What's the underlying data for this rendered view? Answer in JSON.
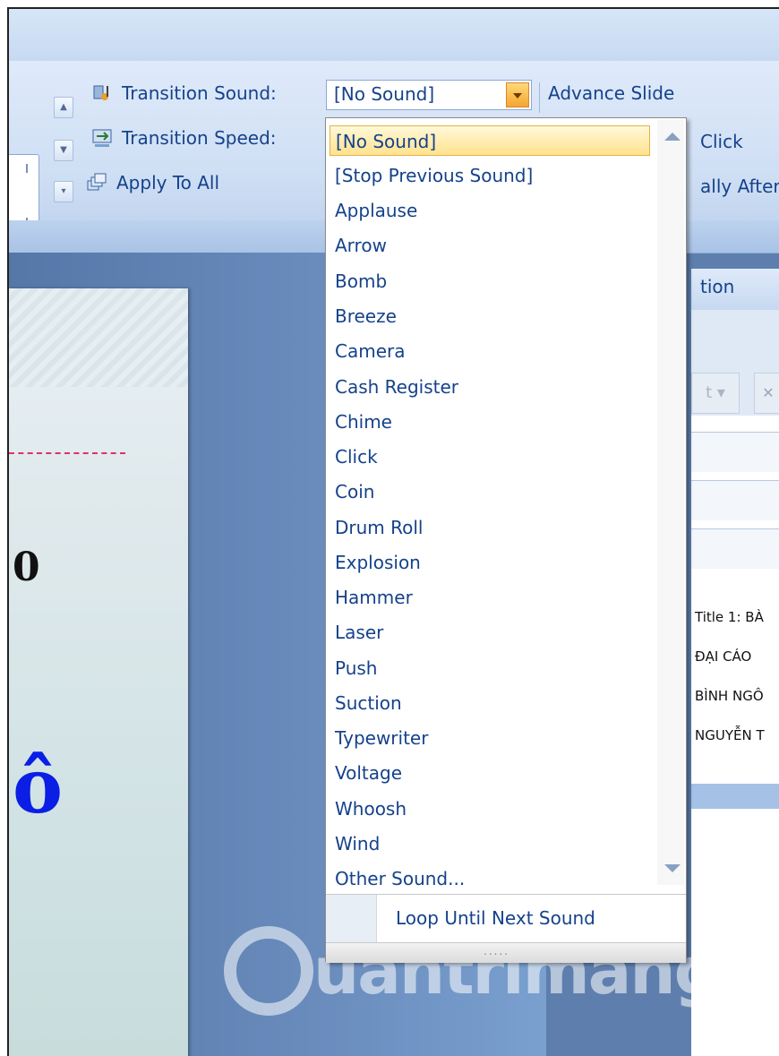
{
  "ribbon": {
    "transition_sound_label": "Transition Sound:",
    "transition_speed_label": "Transition Speed:",
    "apply_to_all_label": "Apply To All",
    "sound_value": "[No Sound]",
    "advance_slide_label": "Advance Slide",
    "on_click_partial": "Click",
    "auto_after_partial": "ally After",
    "icons": [
      "transition-sound-icon",
      "transition-speed-icon",
      "apply-to-all-icon"
    ]
  },
  "sound_dropdown": {
    "selected": "[No Sound]",
    "items": [
      "[No Sound]",
      "[Stop Previous Sound]",
      "Applause",
      "Arrow",
      "Bomb",
      "Breeze",
      "Camera",
      "Cash Register",
      "Chime",
      "Click",
      "Coin",
      "Drum Roll",
      "Explosion",
      "Hammer",
      "Laser",
      "Push",
      "Suction",
      "Typewriter",
      "Voltage",
      "Whoosh",
      "Wind",
      "Other Sound..."
    ],
    "loop_label": "Loop Until Next Sound",
    "grip": "....."
  },
  "task_pane": {
    "header_partial": "tion",
    "list": [
      "Title 1: BÀ",
      "ĐẠI CÁO",
      "BÌNH NGÔ",
      "NGUYỄN T"
    ]
  },
  "slide": {
    "number_partial": "0",
    "letter_partial": "ô"
  },
  "watermark": {
    "text": "uantrimang"
  },
  "colors": {
    "ribbon_text": "#15428b",
    "selected_bg": "#ffe28e",
    "slide_letter": "#0a1ee6"
  }
}
